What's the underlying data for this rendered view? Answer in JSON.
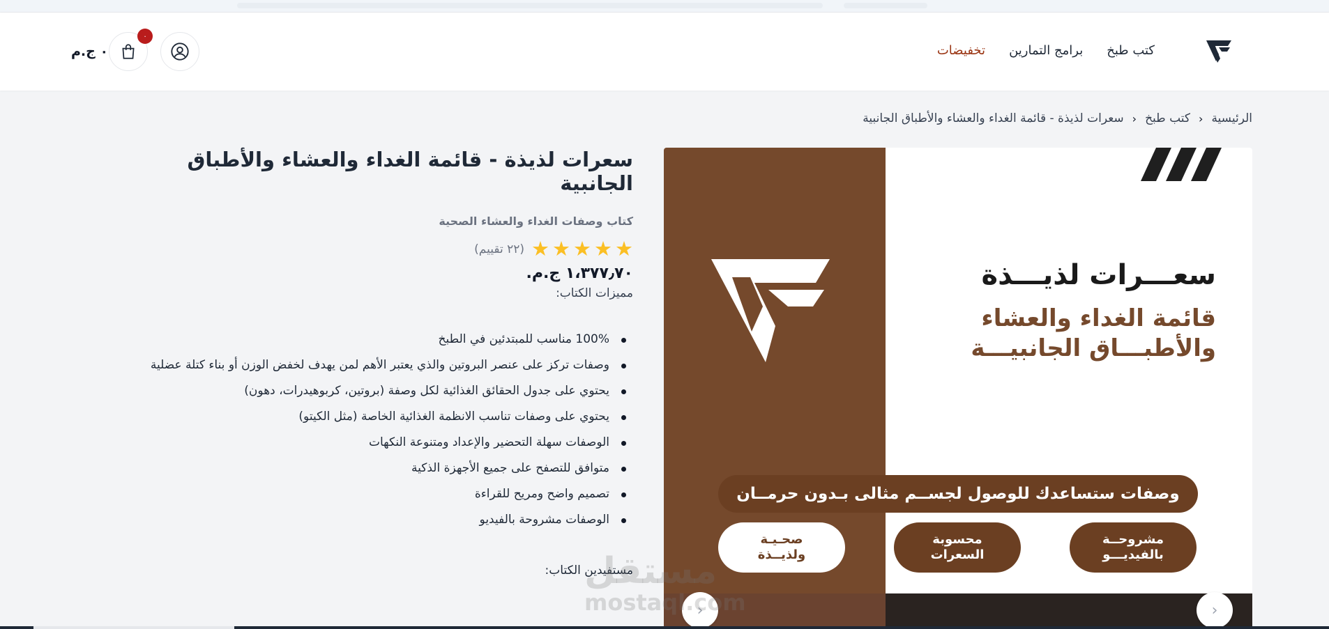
{
  "header": {
    "nav": [
      {
        "label": "كتب طبخ"
      },
      {
        "label": "برامج التمارين"
      },
      {
        "label": "تخفيضات"
      }
    ],
    "cart_badge": "٠",
    "cart_total": "٠ ج.م"
  },
  "breadcrumb": [
    "الرئيسية",
    "كتب طبخ",
    "سعرات لذيذة - قائمة الغداء والعشاء والأطباق الجانبية"
  ],
  "product": {
    "title": "سعرات لذيذة - قائمة الغداء والعشاء والأطباق الجانبية",
    "subtitle": "كتاب وصفات الغداء والعشاء الصحية",
    "rating": 5,
    "rating_count": "(٢٢ تقييم)",
    "price": "١،٣٧٧٫٧٠ ج.م.",
    "features_label": "مميزات الكتاب:",
    "features": [
      "100% مناسب للمبتدئين في الطبخ",
      "وصفات تركز على عنصر البروتين والذي يعتبر الأهم لمن يهدف لخفض الوزن أو بناء كتلة عضلية",
      "يحتوي على جدول الحقائق الغذائية لكل وصفة (بروتين، كربوهيدرات، دهون)",
      "يحتوي على وصفات تناسب الانظمة الغذائية الخاصة (مثل الكيتو)",
      "الوصفات سهلة التحضير والإعداد ومتنوعة النكهات",
      "متوافق للتصفح على جميع الأجهزة الذكية",
      "تصميم واضح ومريح للقراءة",
      "الوصفات مشروحة بالفيديو"
    ],
    "beneficiaries_label": "مستفيدين الكتاب:"
  },
  "cover": {
    "title_line1": "سعـــرات لذيـــذة",
    "title_line2": "قائمة الغداء والعشاء",
    "title_line3": "والأطبـــاق الجانبيـــة",
    "tagline": "وصفات ستساعدك للوصول لجســم مثالى بـدون حرمــان",
    "pills": [
      {
        "text": "مشروحــة\nبالفيديـــو",
        "style": "brown"
      },
      {
        "text": "محسوبة\nالسعرات",
        "style": "brown"
      },
      {
        "text": "صحـيـة\nولذيــذة",
        "style": "white"
      }
    ]
  },
  "watermark": {
    "line1": "مستقل",
    "line2": "mostaql.com"
  },
  "colors": {
    "brand_brown": "#75492c",
    "sale": "#9a3412",
    "star": "#fbbf24",
    "badge": "#b91c1c"
  }
}
